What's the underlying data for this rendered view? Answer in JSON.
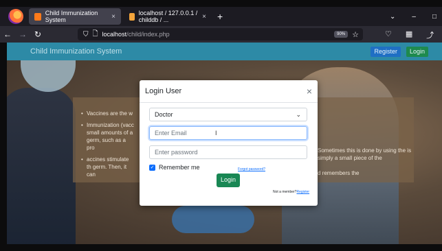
{
  "browser": {
    "tabs": [
      {
        "label": "Child Immunization System",
        "close": "×"
      },
      {
        "label": "localhost / 127.0.0.1 / childdb / ...",
        "close": "×"
      }
    ],
    "new_tab": "+",
    "window_controls": [
      "⌄",
      "–",
      "□"
    ],
    "url_host": "localhost",
    "url_path": "/child/index.php",
    "zoom": "90%"
  },
  "site": {
    "brand": "Child Immunization System",
    "register": "Register",
    "login": "Login"
  },
  "hero": {
    "left_bullets": [
      "Vaccines are the w",
      "Immunization (vacc small amounts of a germ, such as a pro",
      "accines stimulate th germ. Then, it can"
    ],
    "right_fragments": [
      "Sometimes this is done by using the is simply a small piece of the",
      "d remembers the"
    ]
  },
  "modal": {
    "title": "Login User",
    "close": "×",
    "role_selected": "Doctor",
    "email_placeholder": "Enter Email",
    "password_placeholder": "Enter password",
    "remember_label": "Remember me",
    "forgot_label": "Forgot password?",
    "submit_label": "Login",
    "member_text": "Not a member?",
    "register_link": "Register"
  }
}
